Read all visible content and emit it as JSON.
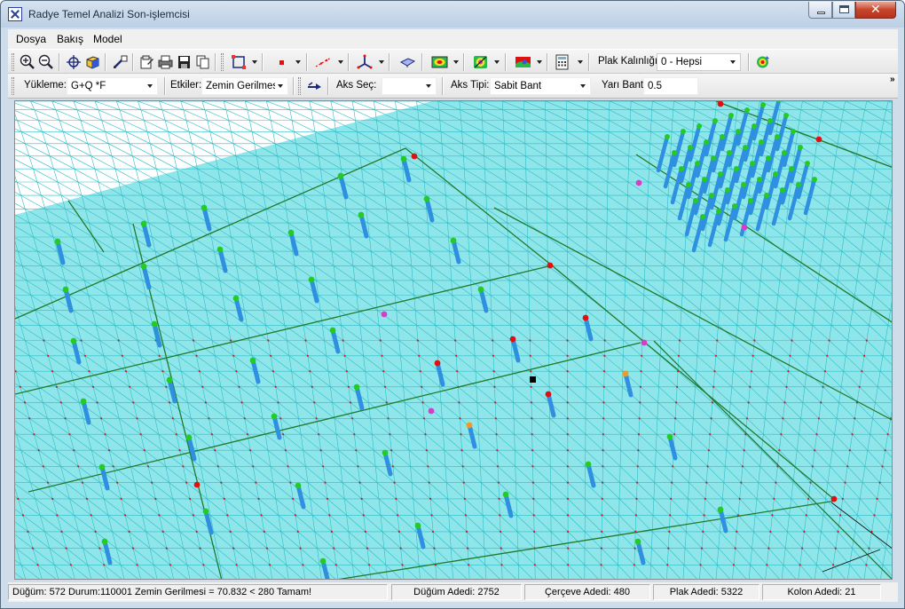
{
  "window": {
    "title": "Radye Temel Analizi Son-işlemcisi"
  },
  "menu": [
    {
      "label": "Dosya"
    },
    {
      "label": "Bakış"
    },
    {
      "label": "Model"
    }
  ],
  "toolbar1": {
    "plate_thickness_label": "Plak Kalınlığı:",
    "plate_thickness_value": "0 - Hepsi"
  },
  "toolbar2": {
    "loading_label": "Yükleme:",
    "loading_value": "G+Q *F",
    "effects_label": "Etkiler:",
    "effects_value": "Zemin Gerilmesi",
    "axis_select_label": "Aks Seç:",
    "axis_select_value": "",
    "axis_type_label": "Aks Tipi:",
    "axis_type_value": "Sabit Bant",
    "half_band_label": "Yarı Bant:",
    "half_band_value": "0.5",
    "overflow": "»"
  },
  "viewport": {
    "colors": {
      "background": "#ffffff",
      "mesh_fill": "#8fe6ea",
      "mesh_line": "#2fbdc6",
      "beam": "#1f7a2a",
      "column": "#2f8fe0",
      "node_top_ok": "#22cc22",
      "node_top_high": "#e01010",
      "node_top_warn": "#f09a20",
      "node_top_special": "#d63cc8",
      "mesh_node": "#e01020",
      "selected_node": "#000000"
    }
  },
  "status": {
    "message": "Düğüm: 572 Durum:110001  Zemin Gerilmesi = 70.832 < 280 Tamam!",
    "node_count": "Düğüm Adedi: 2752",
    "frame_count": "Çerçeve Adedi: 480",
    "plate_count": "Plak Adedi: 5322",
    "column_count": "Kolon Adedi: 21"
  }
}
